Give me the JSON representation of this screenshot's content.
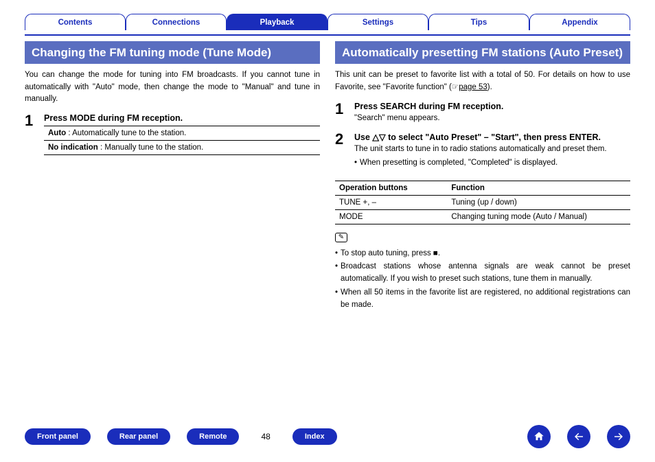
{
  "tabs": [
    "Contents",
    "Connections",
    "Playback",
    "Settings",
    "Tips",
    "Appendix"
  ],
  "activeTab": 2,
  "left": {
    "title": "Changing the FM tuning mode (Tune Mode)",
    "intro": "You can change the mode for tuning into FM broadcasts. If you cannot tune in automatically with \"Auto\" mode, then change the mode to \"Manual\" and tune in manually.",
    "step1_title": "Press MODE during FM reception.",
    "row1_b": "Auto",
    "row1_t": " : Automatically tune to the station.",
    "row2_b": "No indication",
    "row2_t": " : Manually tune to the station."
  },
  "right": {
    "title": "Automatically presetting FM stations (Auto Preset)",
    "intro_a": "This unit can be preset to favorite list with a total of 50. For details on how to use Favorite, see \"Favorite function\" (",
    "intro_link": "page 53",
    "intro_b": ").",
    "step1_title": "Press SEARCH during FM reception.",
    "step1_sub": "\"Search\" menu appears.",
    "step2_pre": "Use ",
    "step2_mid": " to select \"Auto Preset\" – \"Start\", then press ENTER.",
    "step2_sub": "The unit starts to tune in to radio stations automatically and preset them.",
    "step2_b1": "When presetting is completed, \"Completed\" is displayed.",
    "th1": "Operation buttons",
    "th2": "Function",
    "r1c1": "TUNE +, –",
    "r1c2": "Tuning (up / down)",
    "r2c1": "MODE",
    "r2c2": "Changing tuning mode (Auto / Manual)",
    "note1": "To stop auto tuning, press ■.",
    "note2": "Broadcast stations whose antenna signals are weak cannot be preset automatically. If you wish to preset such stations, tune them in manually.",
    "note3": "When all 50 items in the favorite list are registered, no additional registrations can be made."
  },
  "footer": {
    "b1": "Front panel",
    "b2": "Rear panel",
    "b3": "Remote",
    "page": "48",
    "b4": "Index"
  }
}
